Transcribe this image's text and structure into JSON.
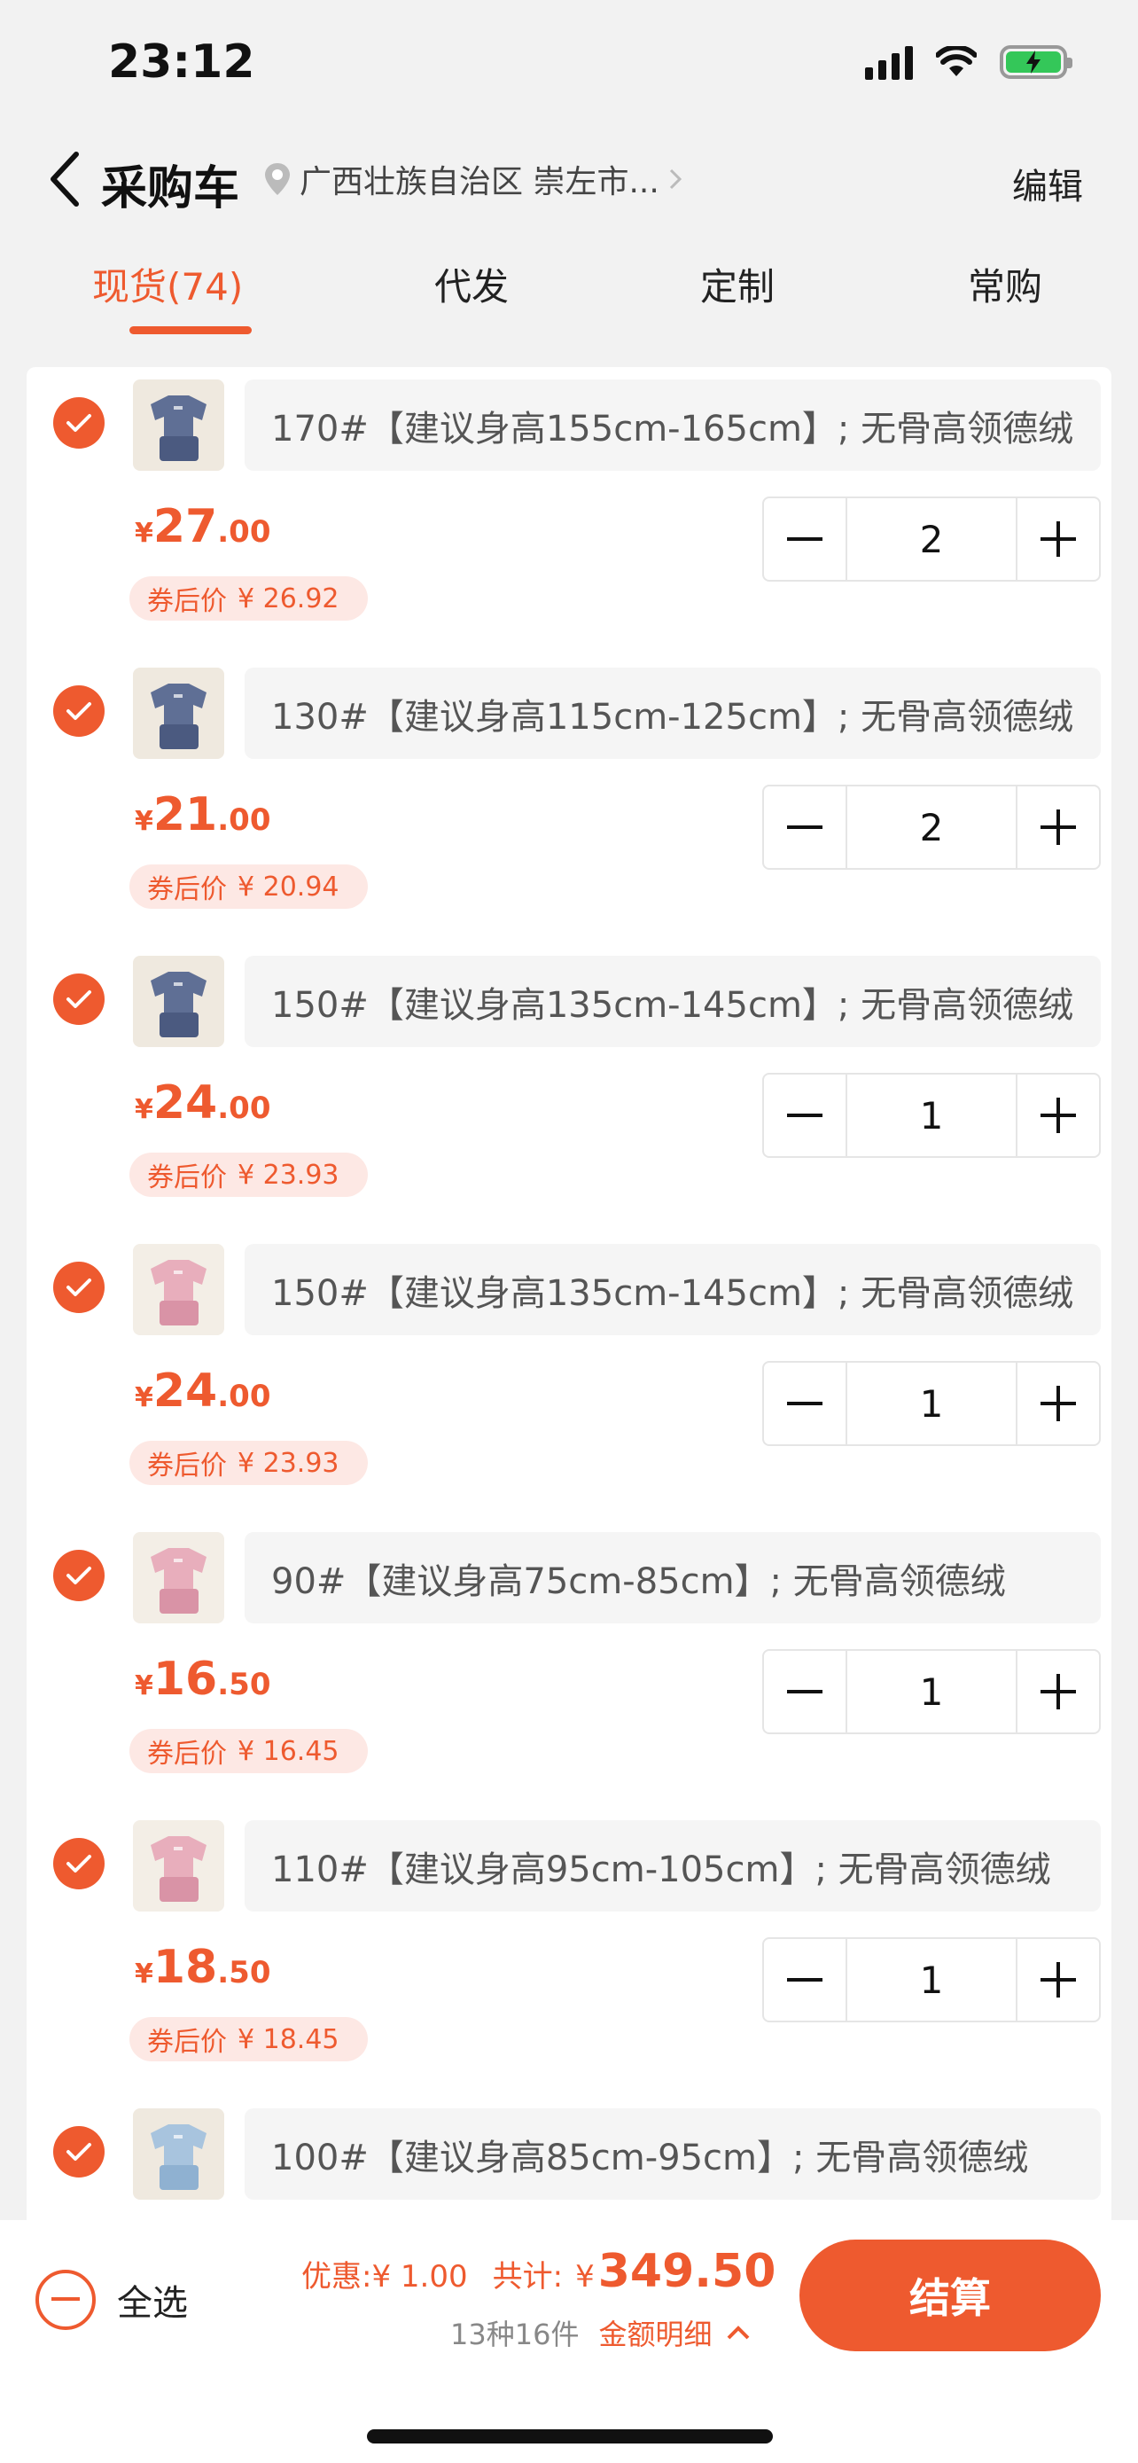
{
  "status": {
    "time": "23:12"
  },
  "header": {
    "title": "采购车",
    "location": "广西壮族自治区 崇左市...",
    "edit_label": "编辑"
  },
  "tabs": [
    {
      "label": "现货(74)",
      "active": true
    },
    {
      "label": "代发",
      "active": false
    },
    {
      "label": "定制",
      "active": false
    },
    {
      "label": "常购",
      "active": false
    }
  ],
  "items": [
    {
      "spec": "170#【建议身高155cm-165cm】; 无骨高领德绒",
      "price_int": "27",
      "price_dec": ".00",
      "coupon_label": "券后价",
      "coupon_price": "¥ 26.92",
      "qty": "2",
      "color": "blue"
    },
    {
      "spec": "130#【建议身高115cm-125cm】; 无骨高领德绒",
      "price_int": "21",
      "price_dec": ".00",
      "coupon_label": "券后价",
      "coupon_price": "¥ 20.94",
      "qty": "2",
      "color": "blue"
    },
    {
      "spec": "150#【建议身高135cm-145cm】; 无骨高领德绒",
      "price_int": "24",
      "price_dec": ".00",
      "coupon_label": "券后价",
      "coupon_price": "¥ 23.93",
      "qty": "1",
      "color": "blue"
    },
    {
      "spec": "150#【建议身高135cm-145cm】; 无骨高领德绒",
      "price_int": "24",
      "price_dec": ".00",
      "coupon_label": "券后价",
      "coupon_price": "¥ 23.93",
      "qty": "1",
      "color": "pink"
    },
    {
      "spec": "90#【建议身高75cm-85cm】; 无骨高领德绒",
      "price_int": "16",
      "price_dec": ".50",
      "coupon_label": "券后价",
      "coupon_price": "¥ 16.45",
      "qty": "1",
      "color": "pink"
    },
    {
      "spec": "110#【建议身高95cm-105cm】; 无骨高领德绒",
      "price_int": "18",
      "price_dec": ".50",
      "coupon_label": "券后价",
      "coupon_price": "¥ 18.45",
      "qty": "1",
      "color": "pink"
    },
    {
      "spec": "100#【建议身高85cm-95cm】; 无骨高领德绒",
      "price_int": "",
      "price_dec": "",
      "coupon_label": "",
      "coupon_price": "",
      "qty": "",
      "color": "lightblue"
    }
  ],
  "yen": "¥",
  "footer": {
    "select_all": "全选",
    "discount_label": "优惠:",
    "discount_value": "¥ 1.00",
    "total_label": "共计:",
    "total_yen": "¥",
    "total_value": "349.50",
    "count": "13种16件",
    "detail_label": "金额明细",
    "checkout": "结算"
  },
  "colors": {
    "accent": "#ee5a2f",
    "coupon_bg": "#fde8e4"
  }
}
